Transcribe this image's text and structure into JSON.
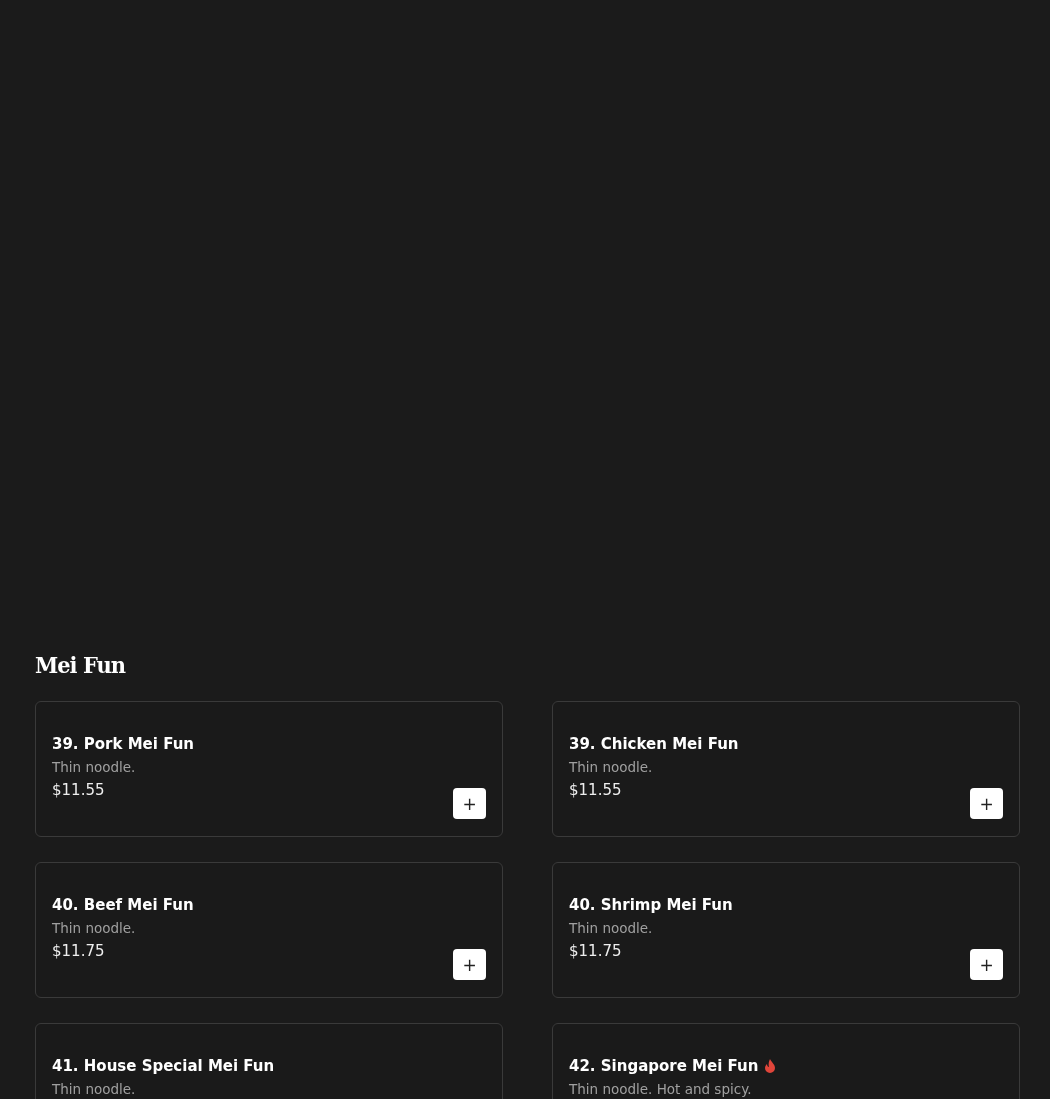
{
  "section": {
    "title": "Mei Fun"
  },
  "items": [
    {
      "name": "39. Pork Mei Fun",
      "description": "Thin noodle.",
      "price": "$11.55",
      "spicy": false,
      "add_button": "+"
    },
    {
      "name": "39. Chicken Mei Fun",
      "description": "Thin noodle.",
      "price": "$11.55",
      "spicy": false,
      "add_button": "+"
    },
    {
      "name": "40. Beef Mei Fun",
      "description": "Thin noodle.",
      "price": "$11.75",
      "spicy": false,
      "add_button": "+"
    },
    {
      "name": "40. Shrimp Mei Fun",
      "description": "Thin noodle.",
      "price": "$11.75",
      "spicy": false,
      "add_button": "+"
    },
    {
      "name": "41. House Special Mei Fun",
      "description": "Thin noodle.",
      "spicy": false
    },
    {
      "name": "42. Singapore Mei Fun",
      "description": "Thin noodle. Hot and spicy.",
      "spicy": true
    }
  ]
}
